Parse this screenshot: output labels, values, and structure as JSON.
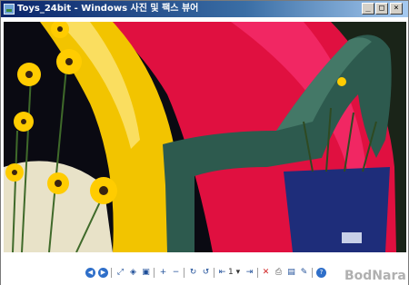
{
  "window": {
    "title": "Toys_24bit - Windows 사진 및 팩스 뷰어",
    "minimize_glyph": "_",
    "maximize_glyph": "□",
    "close_glyph": "×"
  },
  "viewer": {
    "page_number": "1",
    "page_menu_glyph": "▾"
  },
  "toolbar": {
    "prev_icon_glyph": "◀",
    "next_icon_glyph": "▶",
    "best_fit_glyph": "⤢",
    "actual_size_glyph": "◈",
    "slideshow_glyph": "▣",
    "zoom_in_glyph": "+",
    "zoom_out_glyph": "−",
    "rotate_cw_glyph": "↻",
    "rotate_ccw_glyph": "↺",
    "first_page_glyph": "⇤",
    "last_page_glyph": "⇥",
    "delete_glyph": "✕",
    "print_glyph": "⎙",
    "save_glyph": "▤",
    "edit_glyph": "✎",
    "help_glyph": "?"
  },
  "watermark": {
    "text": "BodNara"
  },
  "colors": {
    "slide_red": "#e01040",
    "slide_yellow": "#f2c400",
    "chair_green": "#2d5a4e",
    "flower_yellow": "#ffcc00"
  }
}
